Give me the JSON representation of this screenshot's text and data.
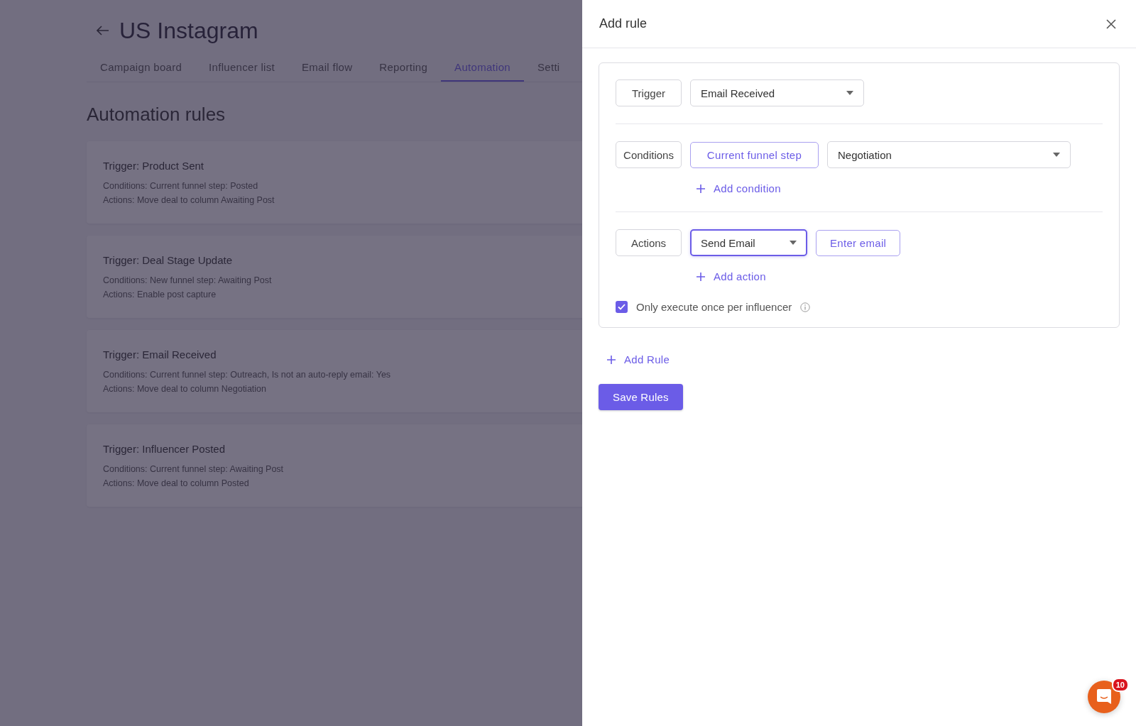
{
  "page": {
    "title": "US Instagram",
    "tabs": [
      {
        "label": "Campaign board",
        "selected": false
      },
      {
        "label": "Influencer list",
        "selected": false
      },
      {
        "label": "Email flow",
        "selected": false
      },
      {
        "label": "Reporting",
        "selected": false
      },
      {
        "label": "Automation",
        "selected": true
      },
      {
        "label": "Setti",
        "selected": false
      }
    ],
    "section_title": "Automation rules",
    "rules": [
      {
        "title": "Trigger: Product Sent",
        "conditions": "Conditions: Current funnel step: Posted",
        "actions": "Actions: Move deal to column Awaiting Post"
      },
      {
        "title": "Trigger: Deal Stage Update",
        "conditions": "Conditions: New funnel step: Awaiting Post",
        "actions": "Actions: Enable post capture"
      },
      {
        "title": "Trigger: Email Received",
        "conditions": "Conditions: Current funnel step: Outreach, Is not an auto-reply email: Yes",
        "actions": "Actions: Move deal to column Negotiation"
      },
      {
        "title": "Trigger: Influencer Posted",
        "conditions": "Conditions: Current funnel step: Awaiting Post",
        "actions": "Actions: Move deal to column Posted"
      }
    ]
  },
  "drawer": {
    "title": "Add rule",
    "trigger": {
      "label": "Trigger",
      "value": "Email Received"
    },
    "conditions": {
      "label": "Conditions",
      "field": "Current funnel step",
      "value": "Negotiation",
      "add": "Add condition"
    },
    "actions": {
      "label": "Actions",
      "value": "Send Email",
      "focused": true,
      "email_button": "Enter email",
      "add": "Add action"
    },
    "once": {
      "label": "Only execute once per influencer",
      "checked": true
    },
    "add_rule": "Add Rule",
    "save": "Save Rules"
  },
  "chat": {
    "badge": "10"
  }
}
